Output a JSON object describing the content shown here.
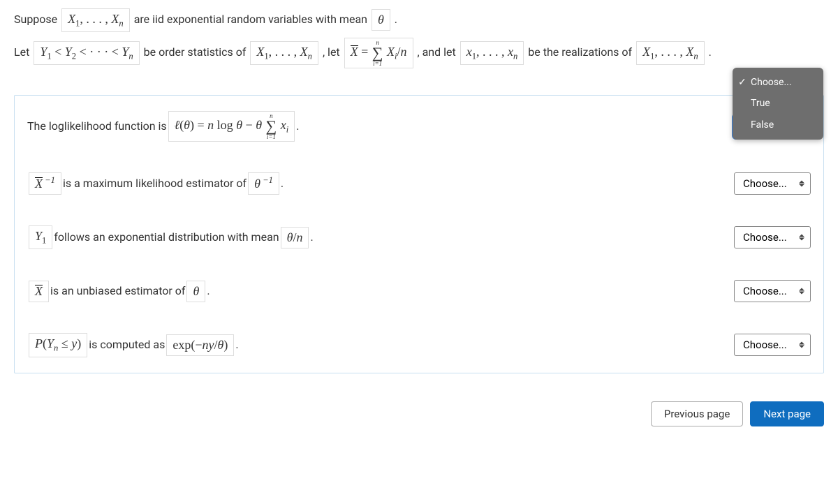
{
  "stem": {
    "line1_prefix": "Suppose ",
    "line1_mid": " are iid exponential random variables with mean ",
    "line1_end": " .",
    "line2_prefix": "Let ",
    "line2_mid1": " be order statistics of ",
    "line2_mid2": " , let ",
    "line2_mid3": " , and let ",
    "line2_mid4": " be the realizations of ",
    "line2_end": " ."
  },
  "rows": [
    {
      "prefix": "The loglikelihood function is ",
      "suffix": " ."
    },
    {
      "mid": " is a maximum likelihood estimator of ",
      "suffix": " ."
    },
    {
      "mid": " follows an exponential distribution with mean ",
      "suffix": " ."
    },
    {
      "mid": " is an unbiased estimator of ",
      "suffix": " ."
    },
    {
      "mid": " is computed as ",
      "suffix": " ."
    }
  ],
  "select": {
    "placeholder": "Choose...",
    "options": [
      "Choose...",
      "True",
      "False"
    ]
  },
  "buttons": {
    "prev": "Previous page",
    "next": "Next page"
  }
}
